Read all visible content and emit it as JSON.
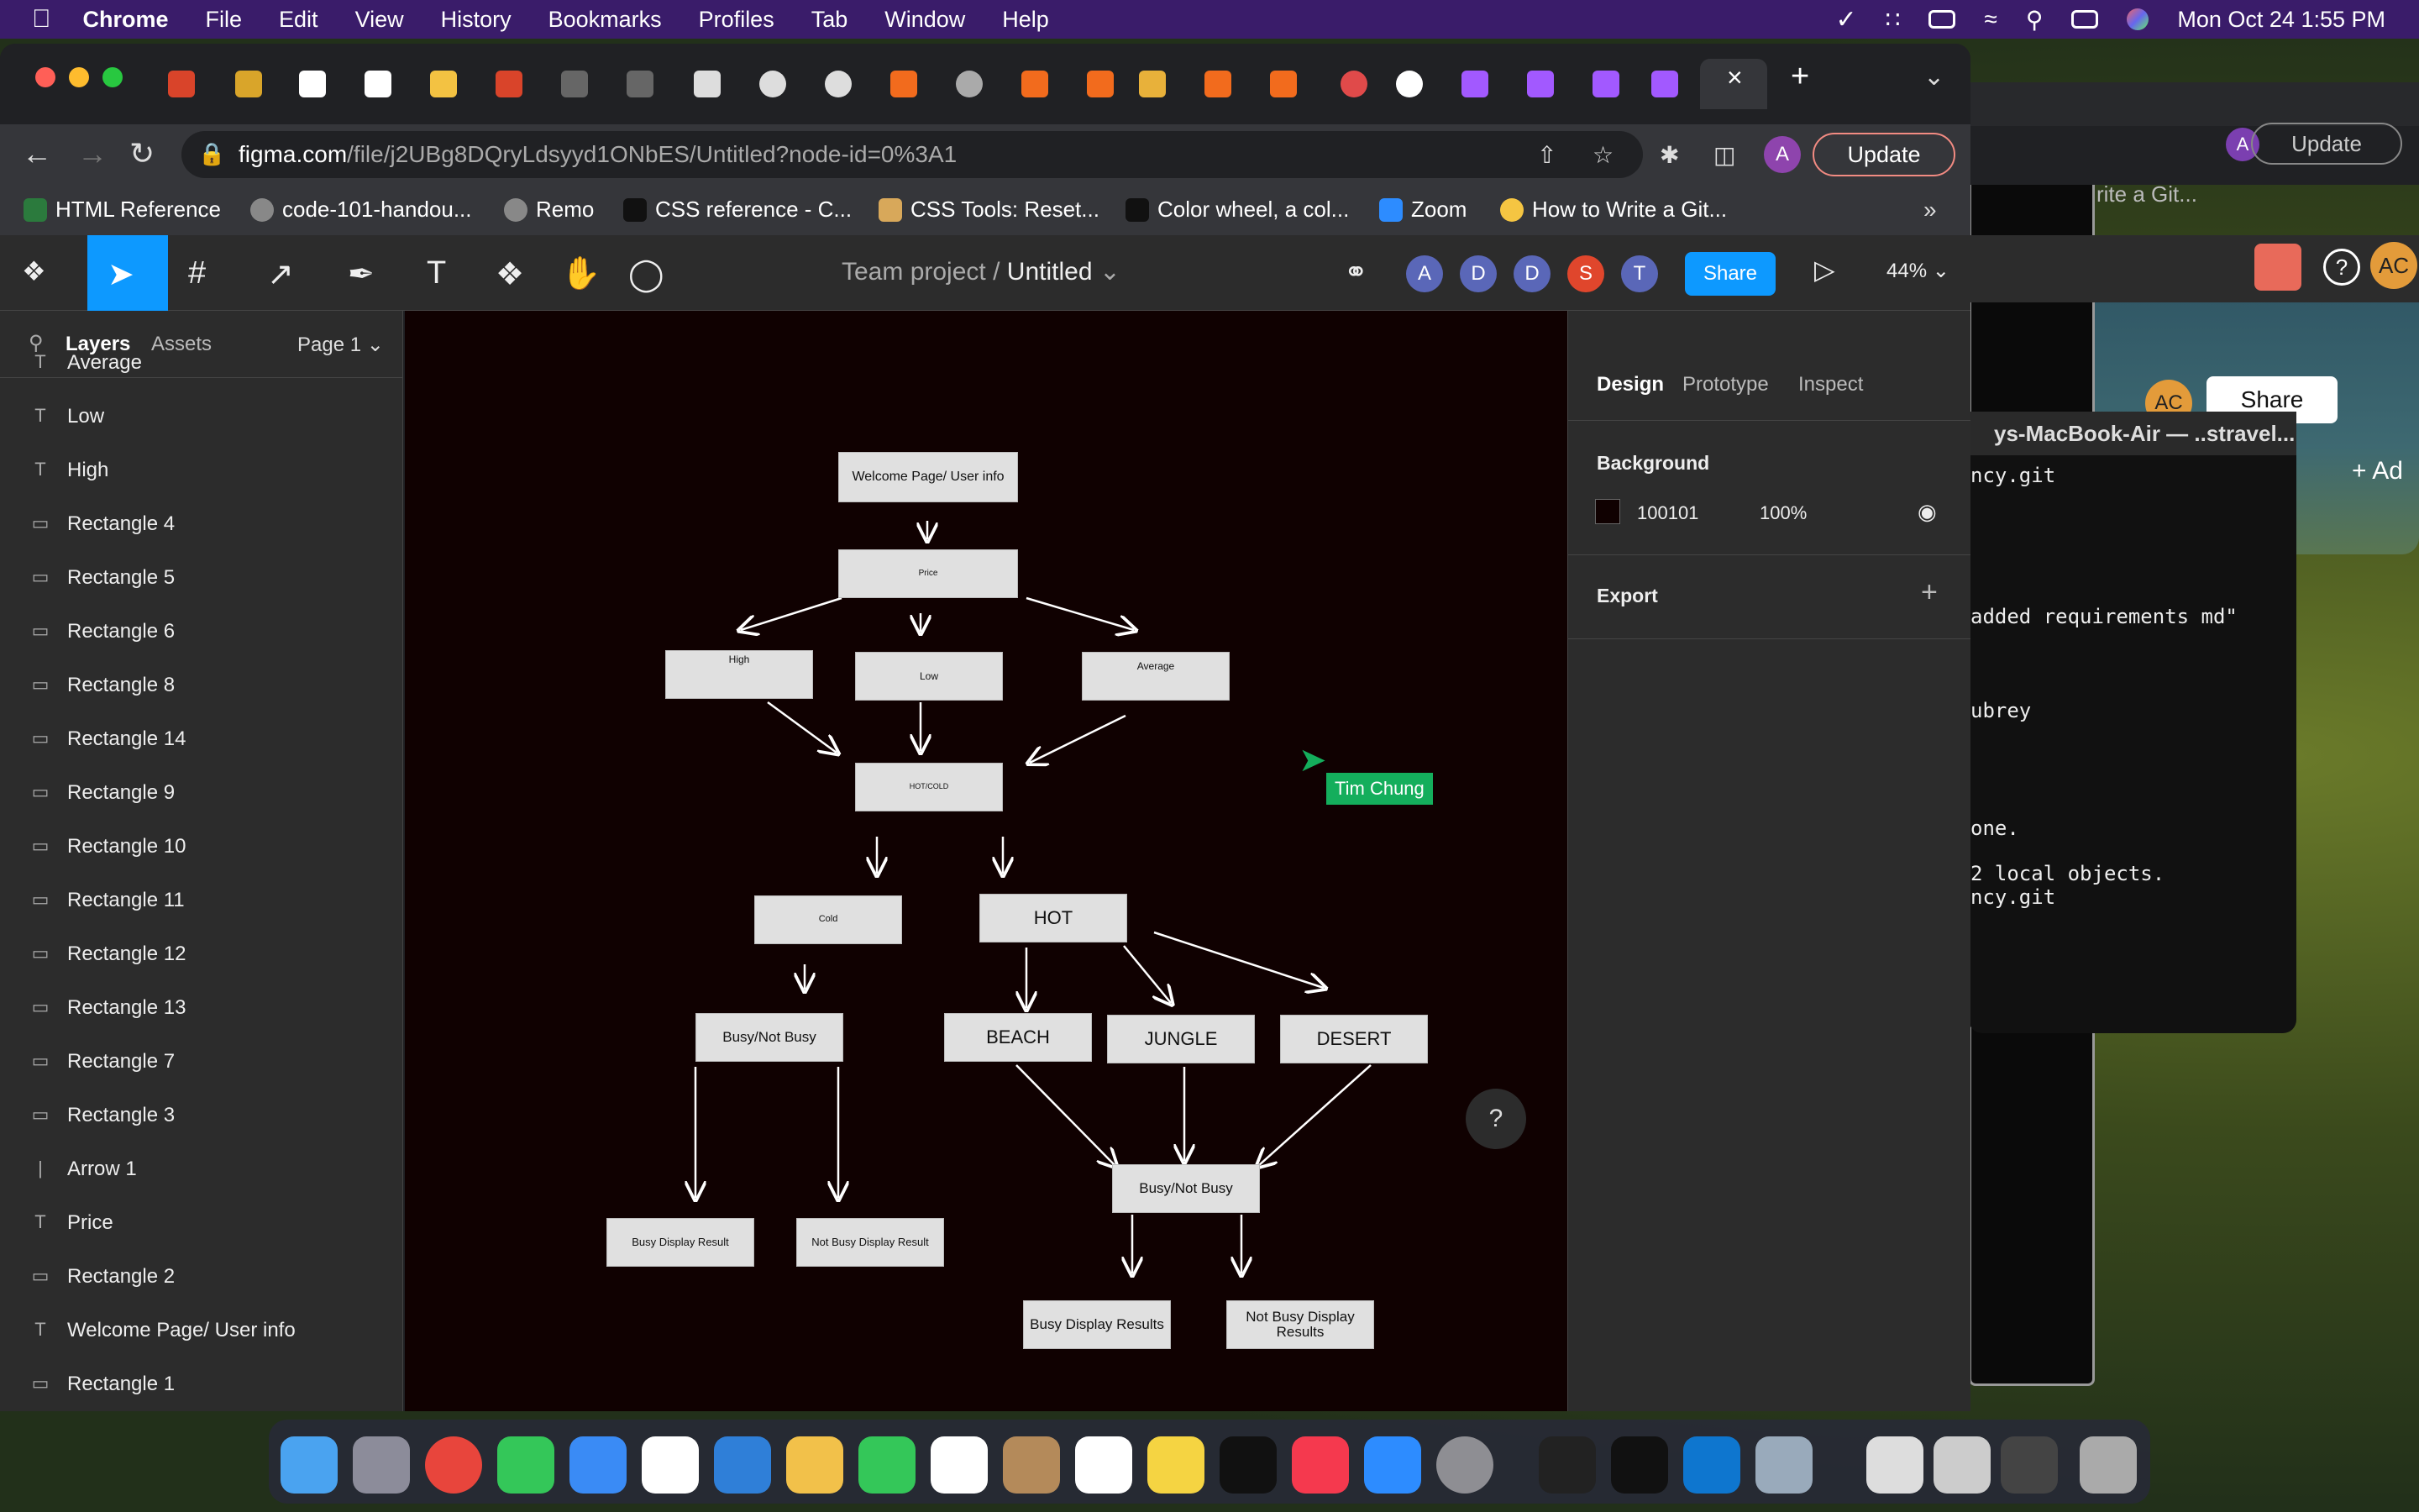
{
  "menubar": {
    "app": "Chrome",
    "items": [
      "File",
      "Edit",
      "View",
      "History",
      "Bookmarks",
      "Profiles",
      "Tab",
      "Window",
      "Help"
    ],
    "datetime": "Mon Oct 24  1:55 PM"
  },
  "browser": {
    "url_host": "figma.com",
    "url_path": "/file/j2UBg8DQryLdsyyd1ONbES/Untitled?node-id=0%3A1",
    "update_label": "Update",
    "avatar_letter": "A",
    "bookmarks": [
      "HTML Reference",
      "code-101-handou...",
      "Remo",
      "CSS reference - C...",
      "CSS Tools: Reset...",
      "Color wheel, a col...",
      "Zoom",
      "How to Write a Git..."
    ]
  },
  "figma": {
    "breadcrumb_team": "Team project",
    "breadcrumb_sep": "/",
    "file_name": "Untitled",
    "collaborators": [
      {
        "letter": "A",
        "color": "#5a67b8"
      },
      {
        "letter": "D",
        "color": "#5a67b8"
      },
      {
        "letter": "D",
        "color": "#5a67b8"
      },
      {
        "letter": "S",
        "color": "#e0462c"
      },
      {
        "letter": "T",
        "color": "#5a67b8"
      }
    ],
    "share_label": "Share",
    "zoom": "44%",
    "layers_tab": "Layers",
    "assets_tab": "Assets",
    "page": "Page 1",
    "layers": [
      {
        "type": "text",
        "name": "Average"
      },
      {
        "type": "text",
        "name": "Low"
      },
      {
        "type": "text",
        "name": "High"
      },
      {
        "type": "rect",
        "name": "Rectangle 4"
      },
      {
        "type": "rect",
        "name": "Rectangle 5"
      },
      {
        "type": "rect",
        "name": "Rectangle 6"
      },
      {
        "type": "rect",
        "name": "Rectangle 8"
      },
      {
        "type": "rect",
        "name": "Rectangle 14"
      },
      {
        "type": "rect",
        "name": "Rectangle 9"
      },
      {
        "type": "rect",
        "name": "Rectangle 10"
      },
      {
        "type": "rect",
        "name": "Rectangle 11"
      },
      {
        "type": "rect",
        "name": "Rectangle 12"
      },
      {
        "type": "rect",
        "name": "Rectangle 13"
      },
      {
        "type": "rect",
        "name": "Rectangle 7"
      },
      {
        "type": "rect",
        "name": "Rectangle 3"
      },
      {
        "type": "line",
        "name": "Arrow 1"
      },
      {
        "type": "text",
        "name": "Price"
      },
      {
        "type": "rect",
        "name": "Rectangle 2"
      },
      {
        "type": "text",
        "name": "Welcome Page/ User info"
      },
      {
        "type": "rect",
        "name": "Rectangle 1"
      }
    ],
    "canvas": {
      "cursor_user": "Tim Chung",
      "boxes": {
        "welcome": "Welcome Page/ User info",
        "price": "Price",
        "high": "High",
        "low": "Low",
        "average": "Average",
        "hotcold": "HOT/COLD",
        "cold": "Cold",
        "hot": "HOT",
        "busy_cold": "Busy/Not Busy",
        "beach": "BEACH",
        "jungle": "JUNGLE",
        "desert": "DESERT",
        "busy_hot": "Busy/Not Busy",
        "busy_display_result": "Busy Display Result",
        "not_busy_display_result": "Not Busy Display Result",
        "busy_display_results": "Busy Display Results",
        "not_busy_display_results": "Not Busy  Display  Results"
      }
    },
    "design_tabs": [
      "Design",
      "Prototype",
      "Inspect"
    ],
    "background_label": "Background",
    "background_hex": "100101",
    "background_opacity": "100%",
    "export_label": "Export"
  },
  "terminal": {
    "title": "ys-MacBook-Air — ..stravel...",
    "lines": [
      "ncy.git",
      "added requirements md\"",
      "ubrey",
      "one.",
      "2 local objects.",
      "ncy.git"
    ]
  },
  "background_window": {
    "update_label": "Update",
    "bookmark": "rite a Git...",
    "share_label": "Share",
    "avatar": "AC",
    "add_label": "Ad"
  }
}
